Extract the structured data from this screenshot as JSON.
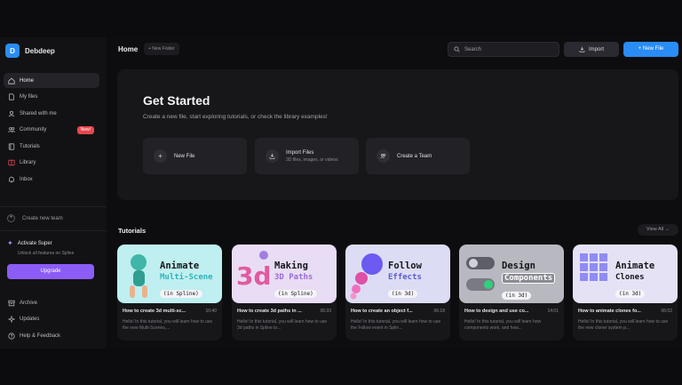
{
  "app": {
    "logo_letter": "D",
    "name": "Debdeep"
  },
  "header": {
    "title": "Home",
    "new_folder_label": "+ New Folder",
    "search_placeholder": "Search",
    "import_label": "Import",
    "new_file_label": "+ New File"
  },
  "sidebar": {
    "items": [
      {
        "label": "Home",
        "icon": "home-icon"
      },
      {
        "label": "My files",
        "icon": "file-icon"
      },
      {
        "label": "Shared with me",
        "icon": "share-icon"
      },
      {
        "label": "Community",
        "icon": "users-icon",
        "badge": "New!"
      },
      {
        "label": "Tutorials",
        "icon": "book-icon"
      },
      {
        "label": "Library",
        "icon": "library-icon"
      },
      {
        "label": "Inbox",
        "icon": "bell-icon"
      }
    ],
    "create_team_label": "Create new team",
    "super": {
      "title": "Activate Super",
      "subtitle": "Unlock all features on Spline",
      "button": "Upgrade"
    },
    "bottom_items": [
      {
        "label": "Archive",
        "icon": "archive-icon"
      },
      {
        "label": "Updates",
        "icon": "update-icon"
      },
      {
        "label": "Help & Feedback",
        "icon": "help-icon"
      }
    ]
  },
  "get_started": {
    "title": "Get Started",
    "subtitle": "Create a new file, start exploring tutorials, or check the library examples!",
    "cards": [
      {
        "label": "New File",
        "sub": "",
        "icon": "plus-icon"
      },
      {
        "label": "Import Files",
        "sub": "3D files, images, or videos",
        "icon": "import-icon"
      },
      {
        "label": "Create a Team",
        "sub": "",
        "icon": "team-icon"
      }
    ]
  },
  "tutorials": {
    "title": "Tutorials",
    "view_all": "View All →",
    "items": [
      {
        "thumb_line1": "Animate",
        "thumb_line2": "Multi-Scene",
        "thumb_pill": "(in Spline)",
        "title": "How to create 3d multi-sc...",
        "duration": "10:40",
        "desc": "Hello! In this tutorial, you will learn how to use the new Multi-Scenes,...",
        "bg": "#bfeff0",
        "line2_color": "#2fb4b8"
      },
      {
        "thumb_line1": "Making",
        "thumb_line2": "3D Paths",
        "thumb_pill": "(in Spline)",
        "title": "How to create 3d paths in ...",
        "duration": "06:33",
        "desc": "Hello! In this tutorial, you will learn how to use 3d paths in Spline to...",
        "bg": "#e8ddf4",
        "line2_color": "#9b6ad8"
      },
      {
        "thumb_line1": "Follow",
        "thumb_line2": "Effects",
        "thumb_pill": "(in 3d)",
        "title": "How to create an object f...",
        "duration": "06:18",
        "desc": "Hello! In this tutorial, you will learn how to use the Follow event in Splin...",
        "bg": "#dcdcf4",
        "line2_color": "#5b5bd6"
      },
      {
        "thumb_line1": "Design",
        "thumb_line2": "Components",
        "thumb_pill": "(in 3d)",
        "title": "How to design and use co...",
        "duration": "14:01",
        "desc": "Hello! In this tutorial, you will learn how components work, and how...",
        "bg": "#b8b8c0",
        "line2_color": "#ffffff"
      },
      {
        "thumb_line1": "Animate",
        "thumb_line2": "Clones",
        "thumb_pill": "(in 3d)",
        "title": "How to animate clones fo...",
        "duration": "06:02",
        "desc": "Hello! In this tutorial, you will learn how to use the new cloner system p...",
        "bg": "#e6e2f6",
        "line2_color": "#15151a"
      }
    ]
  }
}
